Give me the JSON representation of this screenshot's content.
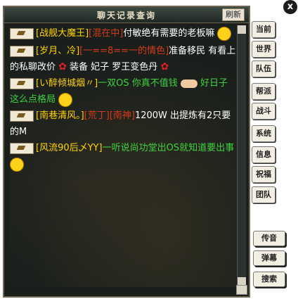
{
  "window": {
    "title": "聊天记录查询",
    "refresh_label": "刷新",
    "close_label": "x"
  },
  "messages": [
    {
      "segments": [
        {
          "text": "[战舰大魔王]",
          "color": "yel"
        },
        {
          "text": "[混在中]",
          "color": "red"
        },
        {
          "text": "付敏绝有需要的老板嘛",
          "color": "wht"
        }
      ],
      "emoji": "smile"
    },
    {
      "segments": [
        {
          "text": "[岁月、冷]",
          "color": "yel"
        },
        {
          "text": "[一==8==一的情色]",
          "color": "red"
        },
        {
          "text": "准备移民 有看上的私聊改价",
          "color": "wht"
        },
        {
          "text": " 装备 妃子 罗王变色丹",
          "color": "wht"
        }
      ],
      "emoji": "rose"
    },
    {
      "segments": [
        {
          "text": "[い醉倾城烟〃]",
          "color": "yel"
        },
        {
          "text": "一双OS 你真不值钱",
          "color": "grn"
        },
        {
          "text": " 好日子 这么点格局",
          "color": "grn"
        }
      ],
      "emoji": "smile"
    },
    {
      "segments": [
        {
          "text": "[南巷清风。]",
          "color": "yel"
        },
        {
          "text": "[荒丁]",
          "color": "red"
        },
        {
          "text": "[南神]",
          "color": "red"
        },
        {
          "text": "1200W 出提炼有2只要的M",
          "color": "wht"
        }
      ],
      "emoji": ""
    },
    {
      "segments": [
        {
          "text": "[风流90后乄YY]",
          "color": "yel"
        },
        {
          "text": "一听说尚功堂出OS就知道要出事",
          "color": "grn"
        }
      ],
      "emoji": "smile"
    }
  ],
  "tabs": [
    "当前",
    "世界",
    "队伍",
    "帮派",
    "战斗",
    "系统",
    "信息",
    "祝福",
    "团队"
  ],
  "tools": [
    "传音",
    "弹幕",
    "搜索"
  ]
}
